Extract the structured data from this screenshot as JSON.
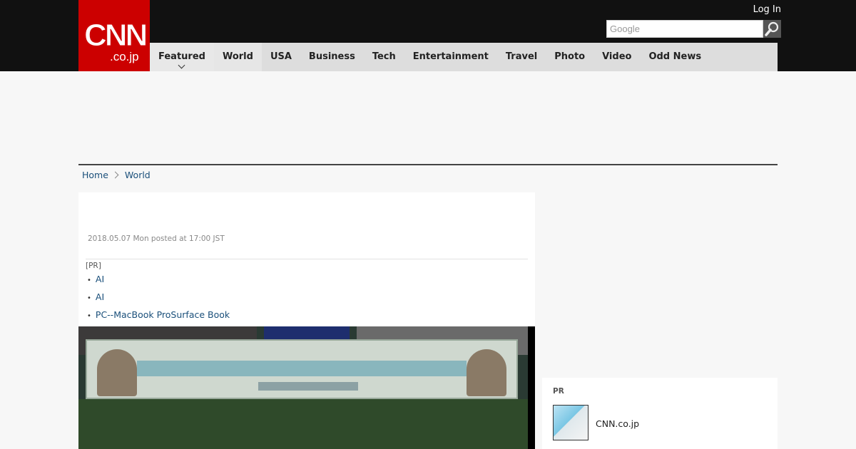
{
  "header": {
    "logo_main": "CNN",
    "logo_sub": ".co.jp",
    "login_label": "Log In",
    "search_placeholder": "Google"
  },
  "nav": {
    "items": [
      {
        "label": "Featured"
      },
      {
        "label": "World"
      },
      {
        "label": "USA"
      },
      {
        "label": "Business"
      },
      {
        "label": "Tech"
      },
      {
        "label": "Entertainment"
      },
      {
        "label": "Travel"
      },
      {
        "label": "Photo"
      },
      {
        "label": "Video"
      },
      {
        "label": "Odd News"
      }
    ]
  },
  "breadcrumb": {
    "home": "Home",
    "current": "World"
  },
  "article": {
    "posted": "2018.05.07 Mon posted at 17:00 JST",
    "pr_label": "[PR]",
    "pr_links": [
      "AI",
      "AI",
      "PC--MacBook ProSurface Book"
    ]
  },
  "sidebar_pr": {
    "label": "PR",
    "item_text": "CNN.co.jp"
  },
  "colors": {
    "brand": "#cc0000",
    "topbar": "#111111",
    "nav_bg": "#dddddd",
    "link": "#1a4f7a"
  }
}
